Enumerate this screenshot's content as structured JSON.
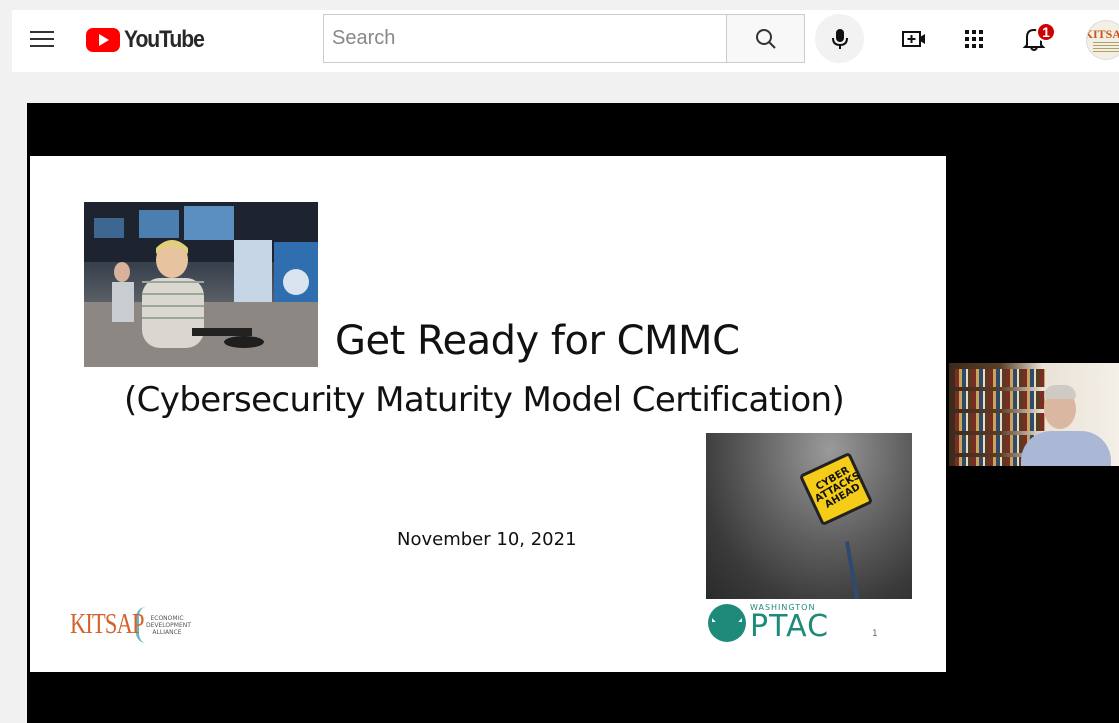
{
  "masthead": {
    "logo_text": "YouTube",
    "search_placeholder": "Search",
    "notification_count": "1",
    "avatar_text": "KITSAP"
  },
  "video": {
    "slide": {
      "title": "Get Ready for CMMC",
      "subtitle": "(Cybersecurity Maturity Model Certification)",
      "date": "November 10, 2021",
      "sign_text": "CYBER ATTACKS AHEAD",
      "kitsap_logo": "KITSAP",
      "kitsap_tagline": "ECONOMIC DEVELOPMENT ALLIANCE",
      "ptac_small": "WASHINGTON",
      "ptac_big": "PTAC",
      "page_number": "1"
    }
  },
  "colors": {
    "brand_red": "#ff0000",
    "kitsap_orange": "#d4622a",
    "ptac_teal": "#1e8a7a",
    "sign_yellow": "#f5cc17"
  },
  "icons": [
    "menu-icon",
    "youtube-logo-icon",
    "search-icon",
    "mic-icon",
    "create-video-icon",
    "apps-grid-icon",
    "bell-icon"
  ]
}
